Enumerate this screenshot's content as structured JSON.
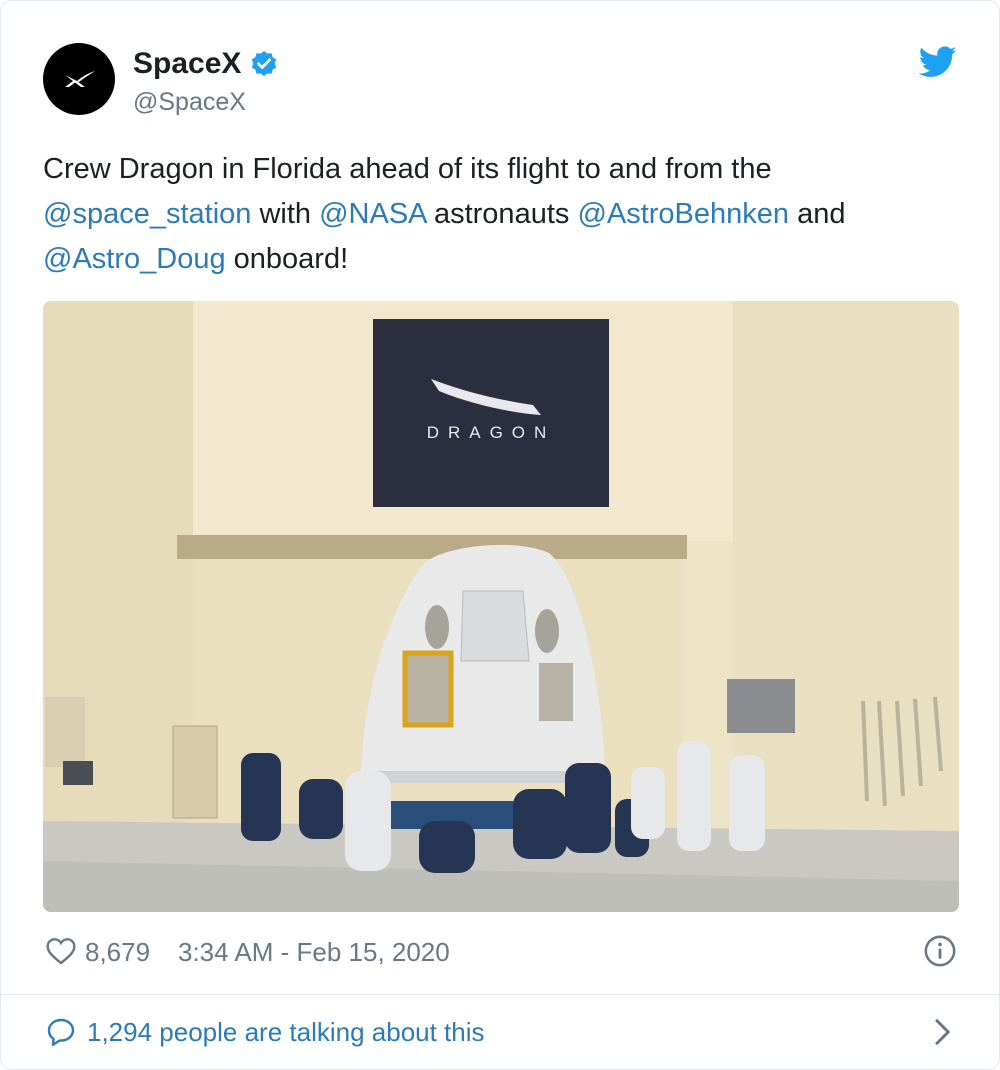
{
  "account": {
    "display_name": "SpaceX",
    "handle": "@SpaceX",
    "verified": true,
    "avatar_icon": "spacex-logo-icon"
  },
  "tweet": {
    "segments": [
      {
        "text": "Crew Dragon in Florida ahead of its flight to and from the ",
        "mention": false
      },
      {
        "text": "@space_station",
        "mention": true
      },
      {
        "text": " with ",
        "mention": false
      },
      {
        "text": "@NASA",
        "mention": true
      },
      {
        "text": " astronauts ",
        "mention": false
      },
      {
        "text": "@AstroBehnken",
        "mention": true
      },
      {
        "text": " and ",
        "mention": false
      },
      {
        "text": "@Astro_Doug",
        "mention": true
      },
      {
        "text": " onboard!",
        "mention": false
      }
    ]
  },
  "media": {
    "banner_text": "DRAGON"
  },
  "footer": {
    "likes": "8,679",
    "timestamp": "3:34 AM - Feb 15, 2020",
    "talking": "1,294 people are talking about this"
  },
  "colors": {
    "text": "#1c2022",
    "secondary": "#697882",
    "link": "#2b7bb9",
    "twitter_blue": "#1da1f2",
    "border": "#e1e8ed"
  },
  "icons": [
    "verified-badge-icon",
    "twitter-bird-icon",
    "heart-icon",
    "info-icon",
    "speech-bubble-icon",
    "chevron-right-icon"
  ]
}
